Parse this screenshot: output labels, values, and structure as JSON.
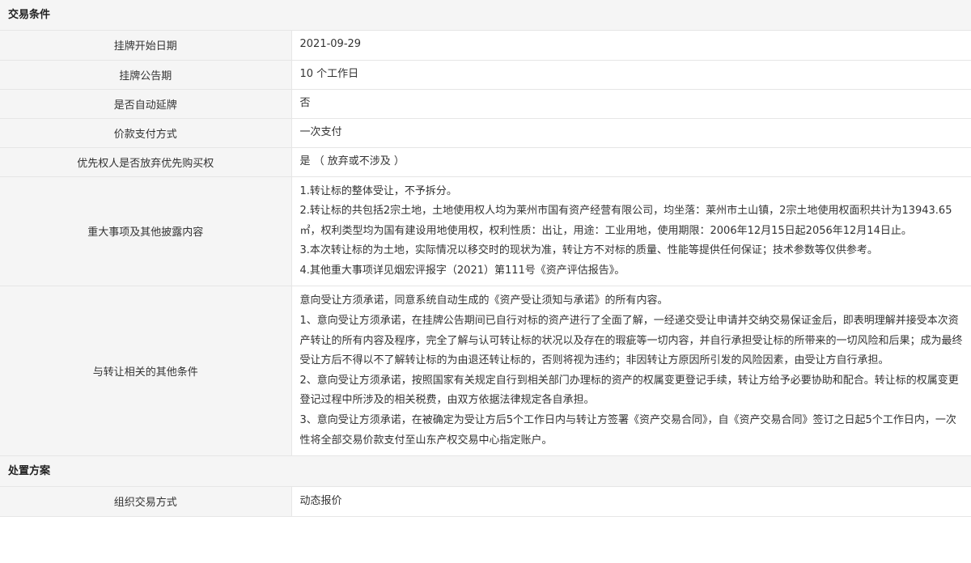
{
  "sections": [
    {
      "title": "交易条件",
      "rows": [
        {
          "label": "挂牌开始日期",
          "value": "2021-09-29"
        },
        {
          "label": "挂牌公告期",
          "value": "10 个工作日"
        },
        {
          "label": "是否自动延牌",
          "value": "否"
        },
        {
          "label": "价款支付方式",
          "value": "一次支付"
        },
        {
          "label": "优先权人是否放弃优先购买权",
          "value": "是 （ 放弃或不涉及 ）"
        },
        {
          "label": "重大事项及其他披露内容",
          "paragraphs": [
            "1.转让标的整体受让，不予拆分。",
            "2.转让标的共包括2宗土地，土地使用权人均为莱州市国有资产经营有限公司，均坐落：莱州市土山镇，2宗土地使用权面积共计为13943.65㎡，权利类型均为国有建设用地使用权，权利性质：出让，用途：工业用地，使用期限：2006年12月15日起2056年12月14日止。",
            "3.本次转让标的为土地，实际情况以移交时的现状为准，转让方不对标的质量、性能等提供任何保证；技术参数等仅供参考。",
            "4.其他重大事项详见烟宏评报字（2021）第111号《资产评估报告》。"
          ]
        },
        {
          "label": "与转让相关的其他条件",
          "paragraphs": [
            "意向受让方须承诺，同意系统自动生成的《资产受让须知与承诺》的所有内容。",
            "1、意向受让方须承诺，在挂牌公告期间已自行对标的资产进行了全面了解，一经递交受让申请并交纳交易保证金后，即表明理解并接受本次资产转让的所有内容及程序，完全了解与认可转让标的状况以及存在的瑕疵等一切内容，并自行承担受让标的所带来的一切风险和后果；成为最终受让方后不得以不了解转让标的为由退还转让标的，否则将视为违约；非因转让方原因所引发的风险因素，由受让方自行承担。",
            "2、意向受让方须承诺，按照国家有关规定自行到相关部门办理标的资产的权属变更登记手续，转让方给予必要协助和配合。转让标的权属变更登记过程中所涉及的相关税费，由双方依据法律规定各自承担。",
            "3、意向受让方须承诺，在被确定为受让方后5个工作日内与转让方签署《资产交易合同》，自《资产交易合同》签订之日起5个工作日内，一次性将全部交易价款支付至山东产权交易中心指定账户。"
          ]
        }
      ]
    },
    {
      "title": "处置方案",
      "rows": [
        {
          "label": "组织交易方式",
          "value": "动态报价"
        }
      ]
    }
  ]
}
